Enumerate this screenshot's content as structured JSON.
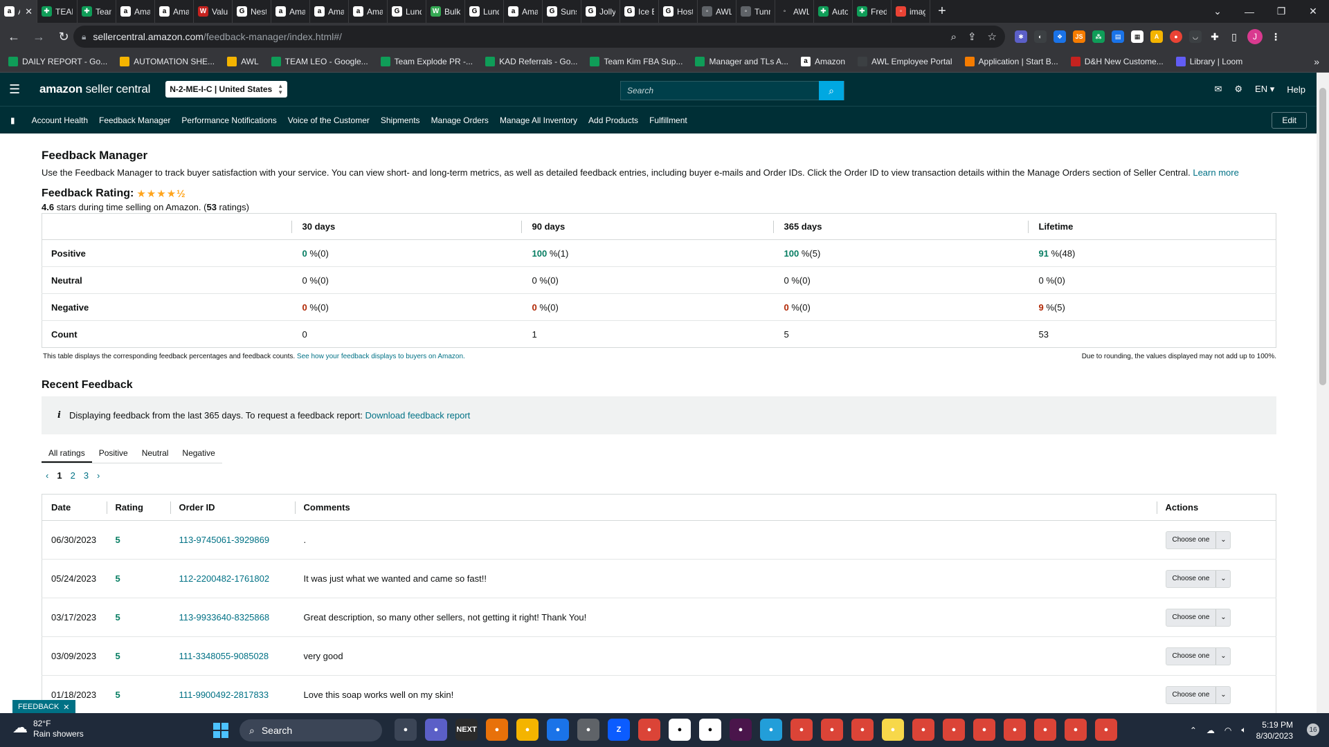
{
  "browser": {
    "tabs": [
      {
        "label": "A",
        "icon": "amazon",
        "color": "#ffffff",
        "text": "#000",
        "active": true
      },
      {
        "label": "TEAM",
        "icon": "sheets",
        "color": "#0f9d58"
      },
      {
        "label": "Team",
        "icon": "sheets",
        "color": "#0f9d58"
      },
      {
        "label": "Ama",
        "icon": "amazon",
        "color": "#ffffff",
        "text": "#000"
      },
      {
        "label": "Ama",
        "icon": "amazon",
        "color": "#ffffff",
        "text": "#000"
      },
      {
        "label": "Value",
        "icon": "w",
        "color": "#c5221f"
      },
      {
        "label": "Nestl",
        "icon": "google",
        "color": "#ffffff",
        "text": "#000"
      },
      {
        "label": "Ama",
        "icon": "amazon",
        "color": "#ffffff",
        "text": "#000"
      },
      {
        "label": "Ama",
        "icon": "amazon",
        "color": "#ffffff",
        "text": "#000"
      },
      {
        "label": "Ama",
        "icon": "amazon",
        "color": "#ffffff",
        "text": "#000"
      },
      {
        "label": "Lund",
        "icon": "google",
        "color": "#ffffff",
        "text": "#000"
      },
      {
        "label": "Bulk",
        "icon": "w",
        "color": "#34a853"
      },
      {
        "label": "Lund",
        "icon": "google",
        "color": "#ffffff",
        "text": "#000"
      },
      {
        "label": "Ama",
        "icon": "amazon",
        "color": "#ffffff",
        "text": "#000"
      },
      {
        "label": "Suns",
        "icon": "google",
        "color": "#ffffff",
        "text": "#000"
      },
      {
        "label": "Jolly",
        "icon": "google",
        "color": "#ffffff",
        "text": "#000"
      },
      {
        "label": "Ice B",
        "icon": "google",
        "color": "#ffffff",
        "text": "#000"
      },
      {
        "label": "Host",
        "icon": "google",
        "color": "#ffffff",
        "text": "#000"
      },
      {
        "label": "AWL",
        "icon": "awl",
        "color": "#5f6368"
      },
      {
        "label": "Tunn",
        "icon": "tunnel",
        "color": "#5f6368"
      },
      {
        "label": "AWL",
        "icon": "awl",
        "color": "#202124"
      },
      {
        "label": "Auto",
        "icon": "sheets",
        "color": "#0f9d58"
      },
      {
        "label": "Fred",
        "icon": "sheets",
        "color": "#0f9d58"
      },
      {
        "label": "imag",
        "icon": "image",
        "color": "#ea4335"
      }
    ],
    "url_host": "sellercentral.amazon.com",
    "url_path": "/feedback-manager/index.html#/",
    "bookmarks": [
      {
        "label": "DAILY REPORT - Go...",
        "color": "#0f9d58"
      },
      {
        "label": "AUTOMATION SHE...",
        "color": "#f4b400"
      },
      {
        "label": "AWL",
        "color": "#f4b400"
      },
      {
        "label": "TEAM LEO - Google...",
        "color": "#0f9d58"
      },
      {
        "label": "Team Explode PR -...",
        "color": "#0f9d58"
      },
      {
        "label": "KAD Referrals - Go...",
        "color": "#0f9d58"
      },
      {
        "label": "Team Kim FBA Sup...",
        "color": "#0f9d58"
      },
      {
        "label": "Manager and TLs A...",
        "color": "#0f9d58"
      },
      {
        "label": "Amazon",
        "color": "#ffffff"
      },
      {
        "label": "AWL Employee Portal",
        "color": "#3c4043"
      },
      {
        "label": "Application | Start B...",
        "color": "#f57c00"
      },
      {
        "label": "D&H New Custome...",
        "color": "#c5221f"
      },
      {
        "label": "Library | Loom",
        "color": "#625df5"
      }
    ]
  },
  "header": {
    "logo_amazon": "amazon",
    "logo_rest": " seller central",
    "store": "N-2-ME-I-C | United States",
    "search_placeholder": "Search",
    "lang": "EN",
    "help": "Help"
  },
  "nav": {
    "items": [
      "Account Health",
      "Feedback Manager",
      "Performance Notifications",
      "Voice of the Customer",
      "Shipments",
      "Manage Orders",
      "Manage All Inventory",
      "Add Products",
      "Fulfillment"
    ],
    "edit": "Edit"
  },
  "page": {
    "title": "Feedback Manager",
    "description": "Use the Feedback Manager to track buyer satisfaction with your service. You can view short- and long-term metrics, as well as detailed feedback entries, including buyer e-mails and Order IDs. Click the Order ID to view transaction details within the Manage Orders section of Seller Central.",
    "learn_more": "Learn more",
    "rating_label": "Feedback Rating:",
    "stars": "★★★★½",
    "rating_value": "4.6",
    "rating_mid": " stars during time selling on Amazon. (",
    "rating_count": "53",
    "rating_end": " ratings)"
  },
  "metrics": {
    "headers": [
      "30 days",
      "90 days",
      "365 days",
      "Lifetime"
    ],
    "rows": [
      {
        "label": "Positive",
        "cells": [
          [
            "0",
            "%(0)"
          ],
          [
            "100",
            "%(1)"
          ],
          [
            "100",
            "%(5)"
          ],
          [
            "91",
            "%(48)"
          ]
        ],
        "style": "g"
      },
      {
        "label": "Neutral",
        "cells": [
          [
            "0",
            "%(0)"
          ],
          [
            "0",
            "%(0)"
          ],
          [
            "0",
            "%(0)"
          ],
          [
            "0",
            "%(0)"
          ]
        ],
        "style": ""
      },
      {
        "label": "Negative",
        "cells": [
          [
            "0",
            "%(0)"
          ],
          [
            "0",
            "%(0)"
          ],
          [
            "0",
            "%(0)"
          ],
          [
            "9",
            "%(5)"
          ]
        ],
        "style": "r"
      },
      {
        "label": "Count",
        "cells": [
          [
            "",
            "0"
          ],
          [
            "",
            "1"
          ],
          [
            "",
            "5"
          ],
          [
            "",
            "53"
          ]
        ],
        "style": ""
      }
    ],
    "note_left": "This table displays the corresponding feedback percentages and feedback counts.",
    "note_link": "See how your feedback displays to buyers on Amazon.",
    "note_right": "Due to rounding, the values displayed may not add up to 100%."
  },
  "recent": {
    "title": "Recent Feedback",
    "info_text": "Displaying feedback from the last 365 days. To request a feedback report:",
    "info_link": "Download feedback report",
    "tabs": [
      "All ratings",
      "Positive",
      "Neutral",
      "Negative"
    ],
    "pages": [
      "1",
      "2",
      "3"
    ],
    "columns": [
      "Date",
      "Rating",
      "Order ID",
      "Comments",
      "Actions"
    ],
    "action_label": "Choose one",
    "rows": [
      {
        "date": "06/30/2023",
        "rating": "5",
        "order": "113-9745061-3929869",
        "comment": "."
      },
      {
        "date": "05/24/2023",
        "rating": "5",
        "order": "112-2200482-1761802",
        "comment": "It was just what we wanted and came so fast!!"
      },
      {
        "date": "03/17/2023",
        "rating": "5",
        "order": "113-9933640-8325868",
        "comment": "Great description, so many other sellers, not getting it right! Thank You!"
      },
      {
        "date": "03/09/2023",
        "rating": "5",
        "order": "111-3348055-9085028",
        "comment": "very good"
      },
      {
        "date": "01/18/2023",
        "rating": "5",
        "order": "111-9900492-2817833",
        "comment": "Love this soap works well on my skin!"
      }
    ],
    "badge": "FEEDBACK"
  },
  "taskbar": {
    "temp": "82°F",
    "weather": "Rain showers",
    "search": "Search",
    "time": "5:19 PM",
    "date": "8/30/2023",
    "notifications": "16",
    "apps": [
      {
        "label": "",
        "color": "#3b4556"
      },
      {
        "label": "",
        "color": "#5b5fc7"
      },
      {
        "label": "NEXT",
        "color": "#2b2b2b"
      },
      {
        "label": "",
        "color": "#e8710a"
      },
      {
        "label": "",
        "color": "#f4b400"
      },
      {
        "label": "",
        "color": "#1a73e8"
      },
      {
        "label": "",
        "color": "#5f6368"
      },
      {
        "label": "Z",
        "color": "#0b5cff"
      },
      {
        "label": "",
        "color": "#db4437"
      },
      {
        "label": "",
        "color": "#ffffff"
      },
      {
        "label": "",
        "color": "#ffffff"
      },
      {
        "label": "",
        "color": "#4a154b"
      },
      {
        "label": "",
        "color": "#229ed9"
      },
      {
        "label": "",
        "color": "#db4437"
      },
      {
        "label": "",
        "color": "#db4437"
      },
      {
        "label": "",
        "color": "#db4437"
      },
      {
        "label": "",
        "color": "#f7d84a"
      },
      {
        "label": "",
        "color": "#db4437"
      },
      {
        "label": "",
        "color": "#db4437"
      },
      {
        "label": "",
        "color": "#db4437"
      },
      {
        "label": "",
        "color": "#db4437"
      },
      {
        "label": "",
        "color": "#db4437"
      },
      {
        "label": "",
        "color": "#db4437"
      },
      {
        "label": "",
        "color": "#db4437"
      }
    ]
  }
}
